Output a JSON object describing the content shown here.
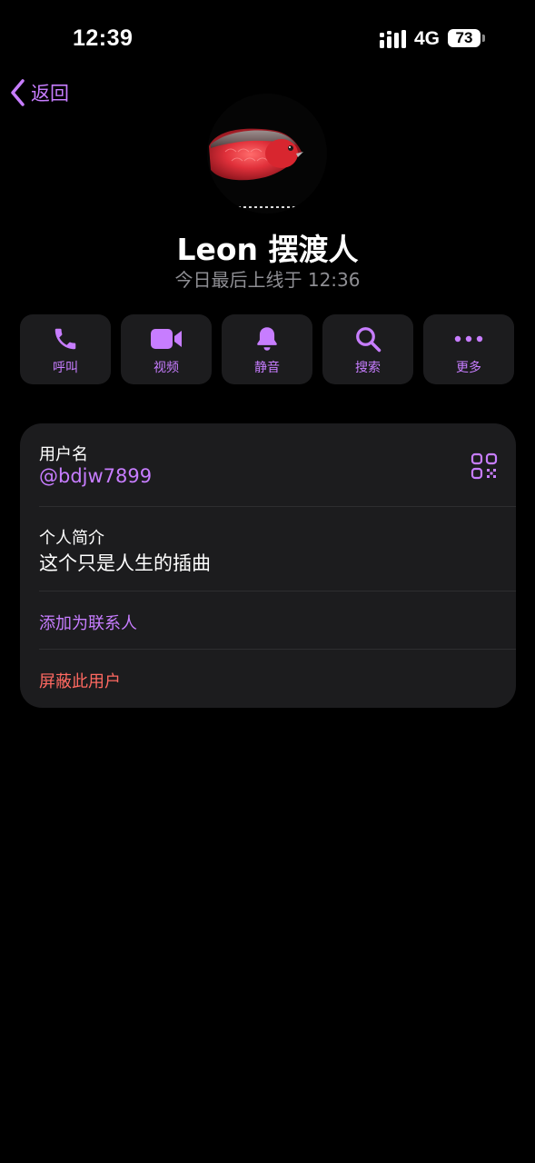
{
  "status_bar": {
    "time": "12:39",
    "network": "4G",
    "battery": "73"
  },
  "nav": {
    "back_label": "返回"
  },
  "profile": {
    "name": "Leon 摆渡人",
    "last_seen": "今日最后上线于 12:36"
  },
  "actions": [
    {
      "label": "呼叫",
      "icon": "phone-icon"
    },
    {
      "label": "视频",
      "icon": "video-icon"
    },
    {
      "label": "静音",
      "icon": "bell-icon"
    },
    {
      "label": "搜索",
      "icon": "search-icon"
    },
    {
      "label": "更多",
      "icon": "more-icon"
    }
  ],
  "info": {
    "username_label": "用户名",
    "username": "@bdjw7899",
    "bio_label": "个人简介",
    "bio": "这个只是人生的插曲",
    "add_contact": "添加为联系人",
    "block_user": "屏蔽此用户"
  },
  "colors": {
    "accent": "#c77dff",
    "danger": "#ff6961",
    "card": "#1c1c1e",
    "background": "#000000",
    "secondary_text": "#8e8e93"
  }
}
